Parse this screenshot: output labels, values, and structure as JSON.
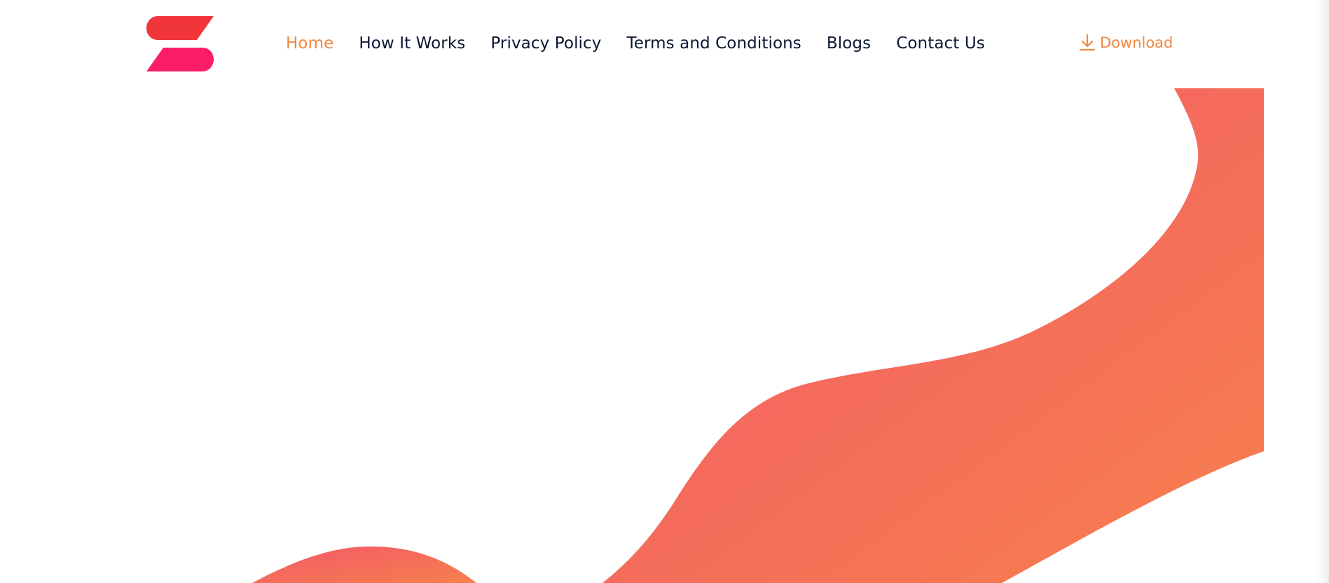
{
  "brand": {
    "logo_icon": "s-logo-icon",
    "logo_color_top": "#f0353b",
    "logo_color_bottom": "#fb1d68"
  },
  "nav": {
    "items": [
      {
        "label": "Home",
        "active": true
      },
      {
        "label": "How It Works",
        "active": false
      },
      {
        "label": "Privacy Policy",
        "active": false
      },
      {
        "label": "Terms and Conditions",
        "active": false
      },
      {
        "label": "Blogs",
        "active": false
      },
      {
        "label": "Contact Us",
        "active": false
      }
    ]
  },
  "download": {
    "label": "Download",
    "icon": "download-icon"
  },
  "theme": {
    "accent": "#f4863f",
    "nav_text": "#0b1633",
    "wave_gradient_start": "#f4586a",
    "wave_gradient_end": "#f6804d",
    "background": "#ffffff"
  }
}
